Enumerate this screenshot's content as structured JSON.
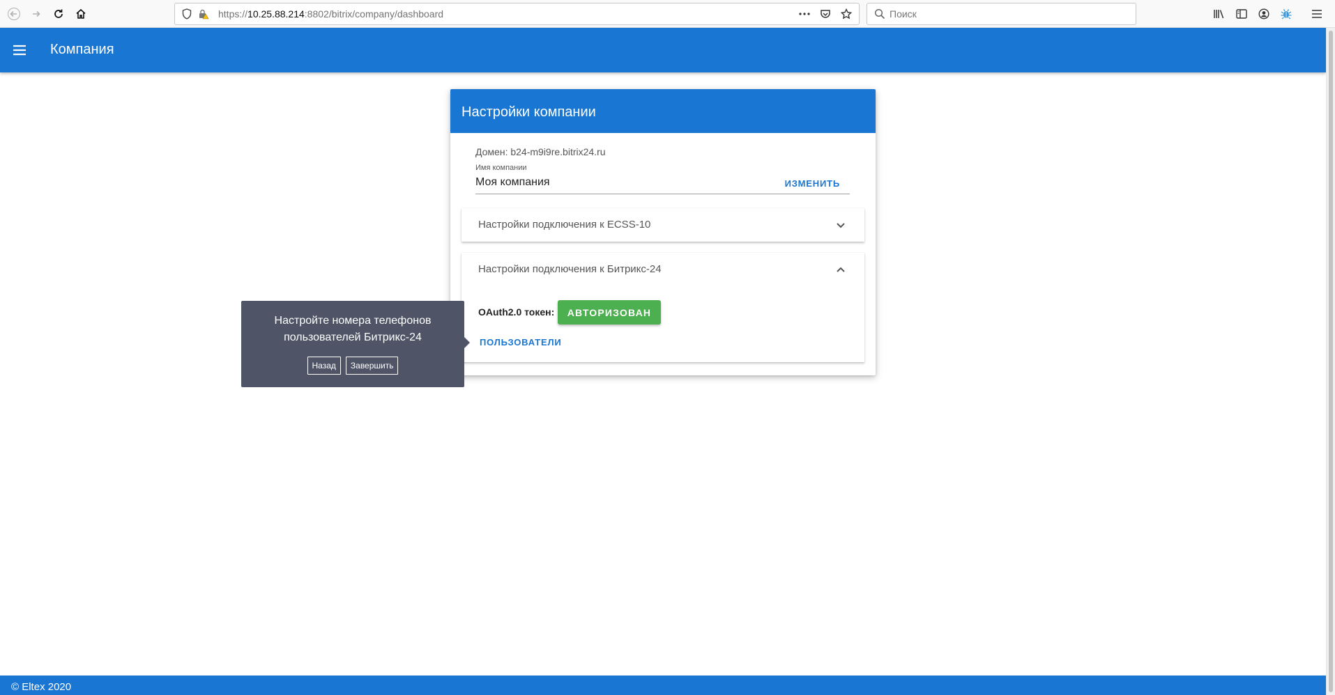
{
  "browser": {
    "url_scheme": "https://",
    "url_host": "10.25.88.214",
    "url_rest": ":8802/bitrix/company/dashboard",
    "search_placeholder": "Поиск",
    "icons": [
      "back-icon",
      "forward-icon",
      "reload-icon",
      "home-icon",
      "shield-icon",
      "lock-warning-icon",
      "more-icon",
      "pocket-icon",
      "bookmark-star-icon",
      "search-icon",
      "library-icon",
      "sidebar-icon",
      "account-icon",
      "extension-icon",
      "menu-icon"
    ]
  },
  "app_bar": {
    "title": "Компания"
  },
  "card": {
    "title": "Настройки компании",
    "domain_line": "Домен: b24-m9i9re.bitrix24.ru",
    "company_name_label": "Имя компании",
    "company_name_value": "Моя компания",
    "change_button": "ИЗМЕНИТЬ",
    "panels": [
      {
        "title": "Настройки подключения к ECSS-10",
        "expanded": false
      },
      {
        "title": "Настройки подключения к Битрикс-24",
        "expanded": true,
        "oauth_label": "OAuth2.0 токен:",
        "auth_button": "АВТОРИЗОВАН",
        "users_link": "ПОЛЬЗОВАТЕЛИ"
      }
    ]
  },
  "tour": {
    "line1": "Настройте номера телефонов",
    "line2": "пользователей Битрикс-24",
    "back_button": "Назад",
    "finish_button": "Завершить"
  },
  "footer": {
    "text": "© Eltex 2020"
  },
  "colors": {
    "primary": "#1976d2",
    "success": "#4caf50",
    "tooltip_bg": "#4f5466"
  }
}
